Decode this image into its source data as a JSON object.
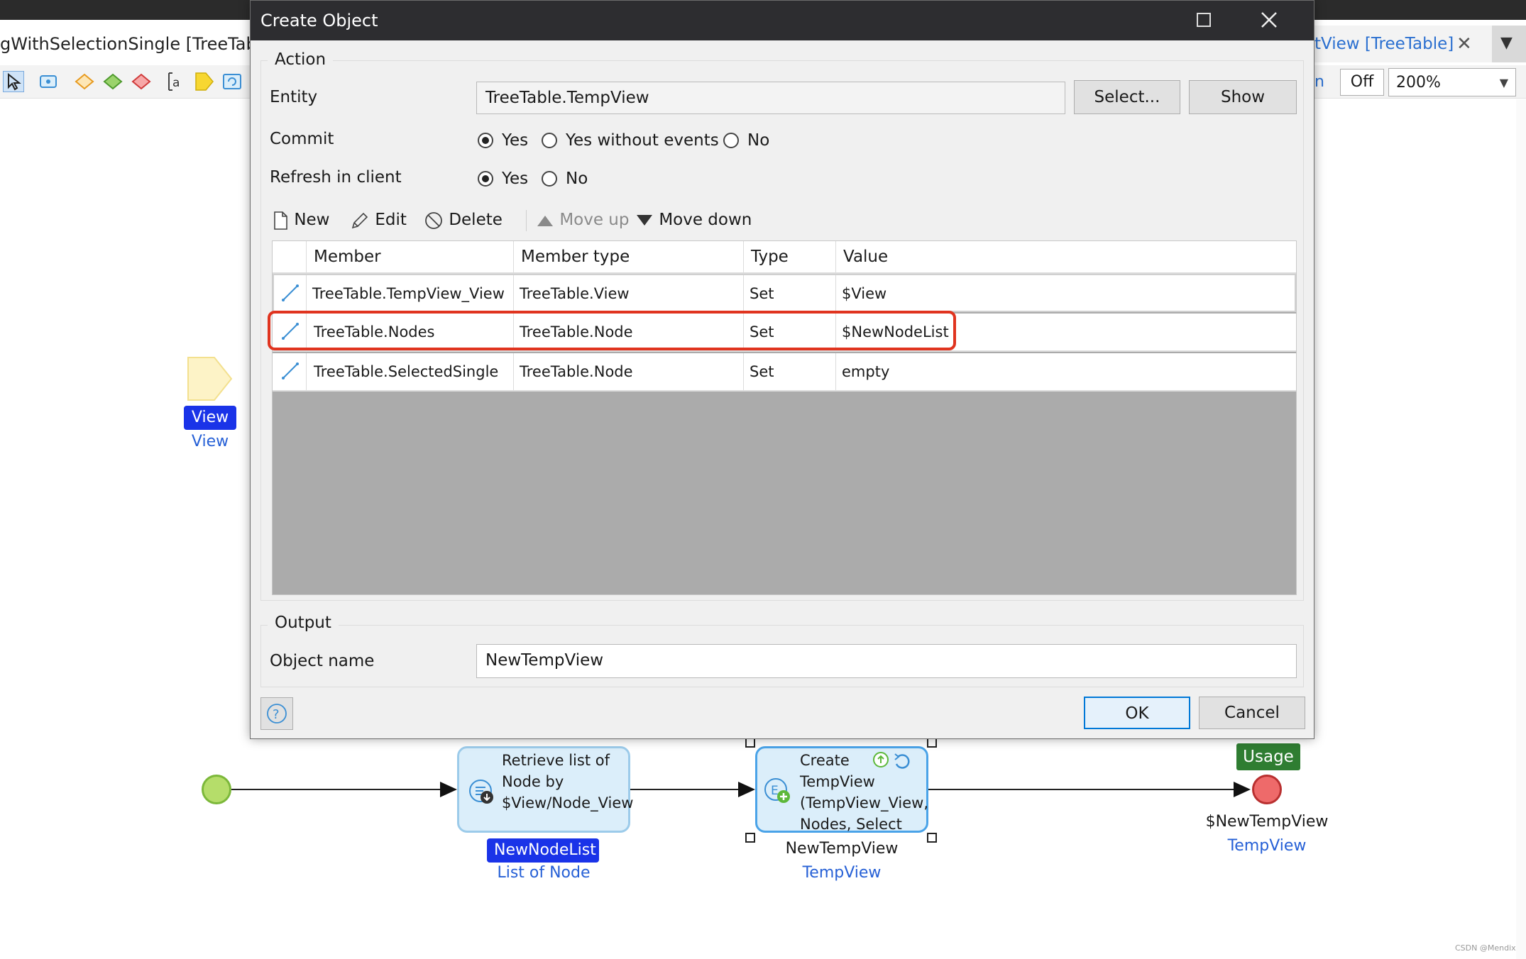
{
  "editor": {
    "tab_left_title": "gWithSelectionSingle [TreeTable]",
    "tab_right_title": "tView [TreeTable]",
    "toggle_label": "Off",
    "zoom_value": "200%",
    "watermark": "CSDN @Mendix"
  },
  "canvas": {
    "parameter": {
      "tag": "View",
      "type": "View"
    },
    "retrieve_activity": {
      "label": "Retrieve list of Node by $View/Node_View",
      "output_tag": "NewNodeList",
      "output_type": "List of Node"
    },
    "create_activity": {
      "label": "Create TempView (TempView_View, Nodes, Select",
      "output_name": "NewTempView",
      "output_type": "TempView"
    },
    "end_event": {
      "usage_tag": "Usage",
      "return_value": "$NewTempView",
      "return_type": "TempView"
    }
  },
  "dialog": {
    "title": "Create Object",
    "action_legend": "Action",
    "entity_label": "Entity",
    "entity_value": "TreeTable.TempView",
    "select_button": "Select...",
    "show_button": "Show",
    "commit_label": "Commit",
    "commit_options": [
      "Yes",
      "Yes without events",
      "No"
    ],
    "commit_selected": "Yes",
    "refresh_label": "Refresh in client",
    "refresh_options": [
      "Yes",
      "No"
    ],
    "refresh_selected": "Yes",
    "toolbar": {
      "new": "New",
      "edit": "Edit",
      "delete": "Delete",
      "move_up": "Move up",
      "move_down": "Move down"
    },
    "columns": [
      "Member",
      "Member type",
      "Type",
      "Value"
    ],
    "rows": [
      {
        "member": "TreeTable.TempView_View",
        "member_type": "TreeTable.View",
        "type": "Set",
        "value": "$View"
      },
      {
        "member": "TreeTable.Nodes",
        "member_type": "TreeTable.Node",
        "type": "Set",
        "value": "$NewNodeList"
      },
      {
        "member": "TreeTable.SelectedSingle",
        "member_type": "TreeTable.Node",
        "type": "Set",
        "value": "empty"
      }
    ],
    "output_legend": "Output",
    "object_name_label": "Object name",
    "object_name_value": "NewTempView",
    "ok_button": "OK",
    "cancel_button": "Cancel"
  },
  "colors": {
    "highlight": "#e0341f",
    "tag_blue": "#1a33e8",
    "link_blue": "#2660d6",
    "start_green": "#b5dd6a",
    "end_red": "#ee6a6a",
    "usage_green": "#2f7d32"
  }
}
